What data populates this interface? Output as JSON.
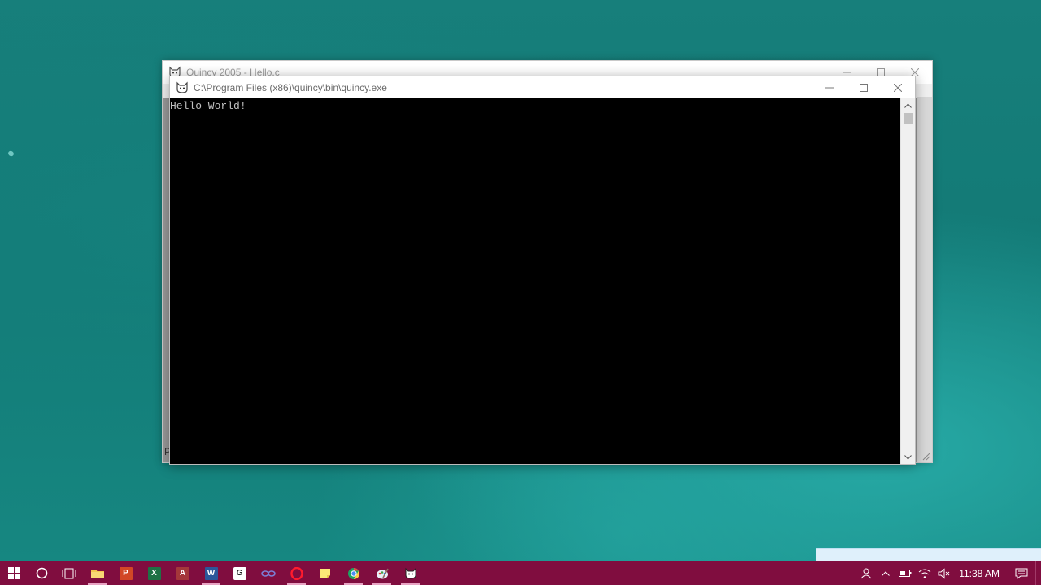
{
  "quincy_window": {
    "title": "Quincy 2005 - Hello.c",
    "left_char": "P"
  },
  "console_window": {
    "title": "C:\\Program Files (x86)\\quincy\\bin\\quincy.exe",
    "output": "Hello World!"
  },
  "taskbar": {
    "apps": [
      {
        "name": "file-explorer",
        "label": ""
      },
      {
        "name": "powerpoint",
        "label": "P"
      },
      {
        "name": "excel",
        "label": "X"
      },
      {
        "name": "access",
        "label": "A"
      },
      {
        "name": "word",
        "label": "W"
      },
      {
        "name": "app-g",
        "label": "G"
      },
      {
        "name": "link-app",
        "label": ""
      },
      {
        "name": "opera",
        "label": ""
      },
      {
        "name": "sticky-notes",
        "label": ""
      },
      {
        "name": "chrome",
        "label": ""
      },
      {
        "name": "paint",
        "label": ""
      },
      {
        "name": "quincy",
        "label": ""
      }
    ],
    "clock": "11:38 AM"
  },
  "colors": {
    "taskbar": "#800d3f",
    "desktop": "#127a76",
    "console_bg": "#000000",
    "console_fg": "#c0c0c0"
  }
}
